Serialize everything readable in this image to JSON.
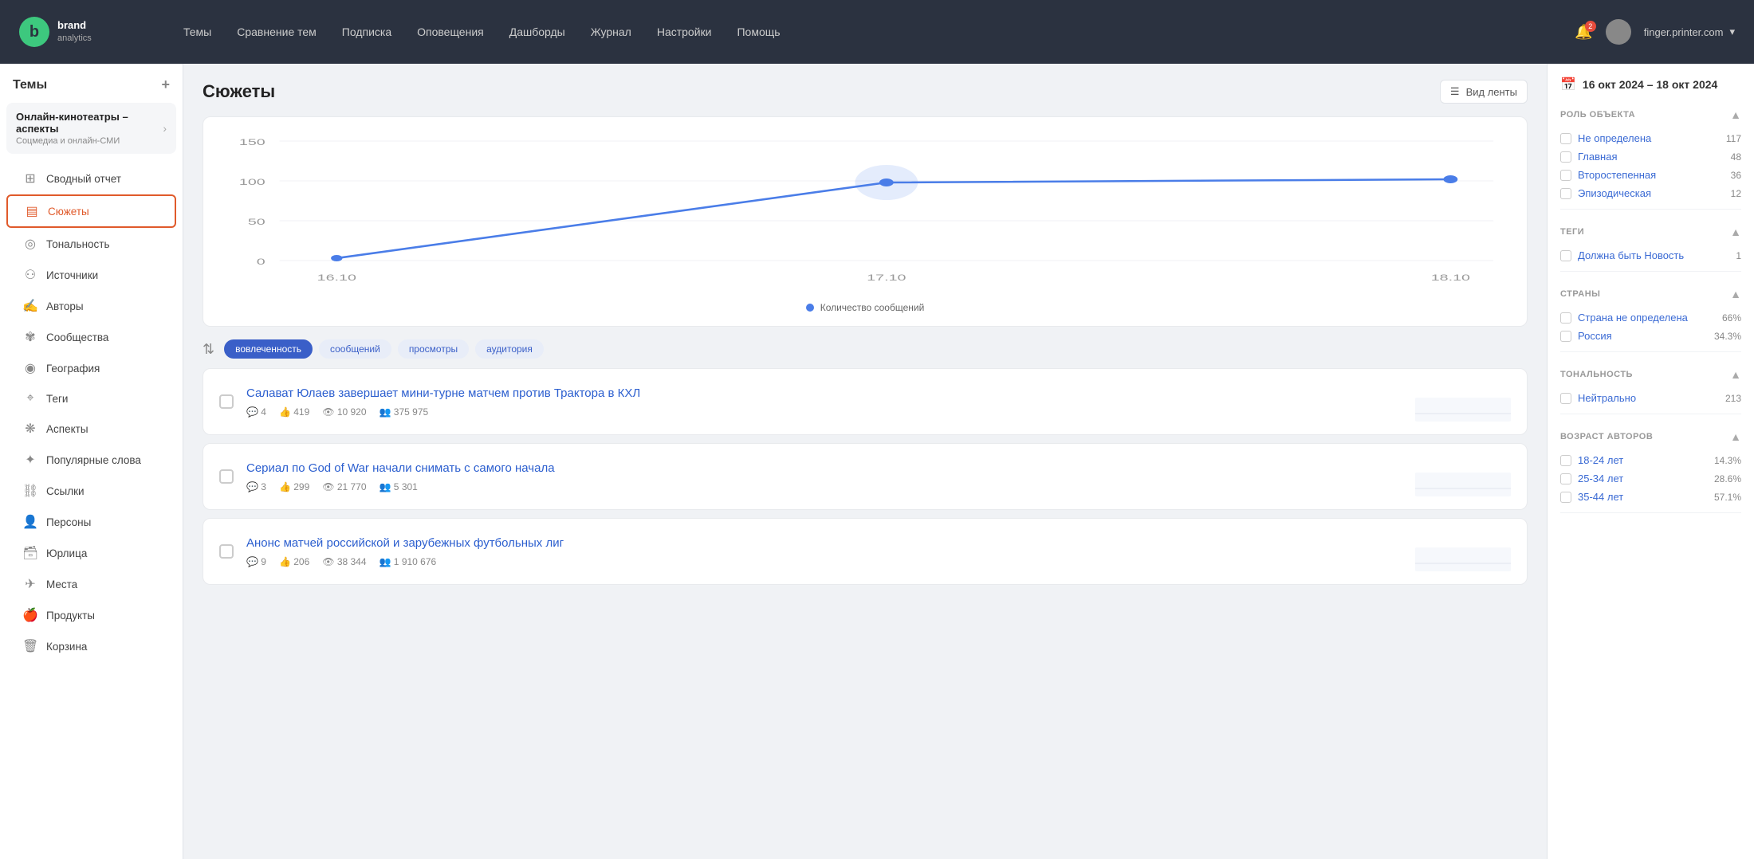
{
  "app": {
    "logo_letter": "b",
    "brand_line1": "brand",
    "brand_line2": "analytics"
  },
  "topnav": {
    "links": [
      "Темы",
      "Сравнение тем",
      "Подписка",
      "Оповещения",
      "Дашборды",
      "Журнал",
      "Настройки",
      "Помощь"
    ],
    "user_email": "finger.printer.com",
    "bell_count": "2"
  },
  "sidebar": {
    "header": "Темы",
    "add_icon": "+",
    "topic_name": "Онлайн-кинотеатры – аспекты",
    "topic_sub": "Соцмедиа и онлайн-СМИ",
    "menu_items": [
      {
        "id": "svodny",
        "label": "Сводный отчет",
        "icon": "⊞"
      },
      {
        "id": "syuzhety",
        "label": "Сюжеты",
        "icon": "▤",
        "active": true
      },
      {
        "id": "tonalnost",
        "label": "Тональность",
        "icon": "◎"
      },
      {
        "id": "istochniki",
        "label": "Источники",
        "icon": "⚇"
      },
      {
        "id": "avtory",
        "label": "Авторы",
        "icon": "✍"
      },
      {
        "id": "soobshchestva",
        "label": "Сообщества",
        "icon": "✾"
      },
      {
        "id": "geografiya",
        "label": "География",
        "icon": "◉"
      },
      {
        "id": "tegi",
        "label": "Теги",
        "icon": "⌖"
      },
      {
        "id": "aspekty",
        "label": "Аспекты",
        "icon": "❋"
      },
      {
        "id": "populyarnye",
        "label": "Популярные слова",
        "icon": "✦"
      },
      {
        "id": "ssylki",
        "label": "Ссылки",
        "icon": "⛓"
      },
      {
        "id": "persony",
        "label": "Персоны",
        "icon": "👤"
      },
      {
        "id": "yurlitsa",
        "label": "Юрлица",
        "icon": "🗃"
      },
      {
        "id": "mesta",
        "label": "Места",
        "icon": "✈"
      },
      {
        "id": "produkty",
        "label": "Продукты",
        "icon": "🍎"
      },
      {
        "id": "korzina",
        "label": "Корзина",
        "icon": "🗑"
      }
    ]
  },
  "content": {
    "title": "Сюжеты",
    "view_toggle_label": "Вид ленты",
    "chart": {
      "y_labels": [
        "150",
        "100",
        "50",
        "0"
      ],
      "x_labels": [
        "16.10",
        "17.10",
        "18.10"
      ],
      "legend": "Количество сообщений",
      "data_points": [
        {
          "x_pct": 5,
          "y_pct": 95,
          "val": 1
        },
        {
          "x_pct": 50,
          "y_pct": 30,
          "val": 103
        },
        {
          "x_pct": 95,
          "y_pct": 28,
          "val": 108
        }
      ]
    },
    "filters": {
      "sort_icon": "≡",
      "tags": [
        {
          "label": "вовлеченность",
          "active": true
        },
        {
          "label": "сообщений",
          "active": false
        },
        {
          "label": "просмотры",
          "active": false
        },
        {
          "label": "аудитория",
          "active": false
        }
      ]
    },
    "stories": [
      {
        "title": "Салават Юлаев завершает мини-турне матчем против Трактора в КХЛ",
        "meta_posts": "4",
        "meta_reactions": "419",
        "meta_views": "10 920",
        "meta_audience": "375 975",
        "sparkline_trend": "up"
      },
      {
        "title": "Сериал по God of War начали снимать с самого начала",
        "meta_posts": "3",
        "meta_reactions": "299",
        "meta_views": "21 770",
        "meta_audience": "5 301",
        "sparkline_trend": "down"
      },
      {
        "title": "Анонс матчей российской и зарубежных футбольных лиг",
        "meta_posts": "9",
        "meta_reactions": "206",
        "meta_views": "38 344",
        "meta_audience": "1 910 676",
        "sparkline_trend": "up"
      }
    ]
  },
  "right_panel": {
    "date_range": "16 окт 2024 – 18 окт 2024",
    "sections": [
      {
        "title": "РОЛЬ ОБЪЕКТА",
        "items": [
          {
            "label": "Не определена",
            "count": "117"
          },
          {
            "label": "Главная",
            "count": "48"
          },
          {
            "label": "Второстепенная",
            "count": "36"
          },
          {
            "label": "Эпизодическая",
            "count": "12"
          }
        ]
      },
      {
        "title": "ТЕГИ",
        "items": [
          {
            "label": "Должна быть Новость",
            "count": "1"
          }
        ]
      },
      {
        "title": "СТРАНЫ",
        "items": [
          {
            "label": "Страна не определена",
            "count": "66%"
          },
          {
            "label": "Россия",
            "count": "34.3%"
          }
        ]
      },
      {
        "title": "ТОНАЛЬНОСТЬ",
        "items": [
          {
            "label": "Нейтрально",
            "count": "213"
          }
        ]
      },
      {
        "title": "ВОЗРАСТ АВТОРОВ",
        "items": [
          {
            "label": "18-24 лет",
            "count": "14.3%"
          },
          {
            "label": "25-34 лет",
            "count": "28.6%"
          },
          {
            "label": "35-44 лет",
            "count": "57.1%"
          }
        ]
      }
    ]
  }
}
